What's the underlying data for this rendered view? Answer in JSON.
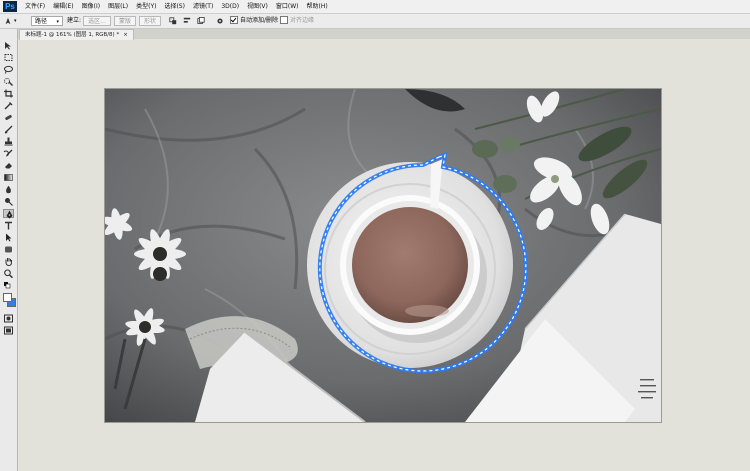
{
  "app": {
    "logo": "Ps"
  },
  "menu": [
    "文件(F)",
    "编辑(E)",
    "图像(I)",
    "图层(L)",
    "类型(Y)",
    "选择(S)",
    "滤镜(T)",
    "3D(D)",
    "视图(V)",
    "窗口(W)",
    "帮助(H)"
  ],
  "options": {
    "mode_value": "路径",
    "create_label": "建立:",
    "selection_btn": "选区...",
    "mask_btn": "蒙版",
    "shape_btn": "形状",
    "auto_add_delete_label": "自动添加/删除",
    "auto_add_delete_checked": true,
    "align_edges_label": "对齐边缘",
    "align_edges_checked": false
  },
  "document": {
    "tab_title": "未标题-1 @ 161% (图层 1, RGB/8) *",
    "close_glyph": "×"
  },
  "tools": [
    "move-tool",
    "marquee-tool",
    "lasso-tool",
    "quick-select-tool",
    "crop-tool",
    "eyedropper-tool",
    "healing-brush-tool",
    "brush-tool",
    "clone-stamp-tool",
    "history-brush-tool",
    "eraser-tool",
    "gradient-tool",
    "blur-tool",
    "dodge-tool",
    "pen-tool",
    "type-tool",
    "path-select-tool",
    "shape-tool",
    "hand-tool",
    "zoom-tool",
    "color-swatches",
    "quick-mask-tool",
    "screen-mode-tool"
  ],
  "active_tool": "pen-tool",
  "colors": {
    "selection_path": "#2e7cf0",
    "foreground": "#ffffff",
    "background": "#3a7be0"
  }
}
